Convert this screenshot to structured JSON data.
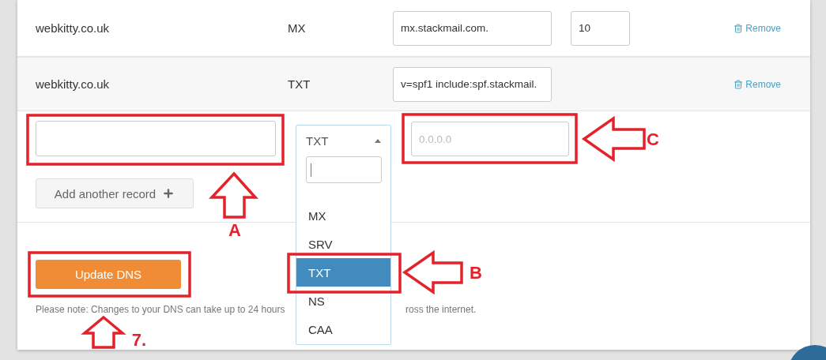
{
  "records": [
    {
      "name": "webkitty.co.uk",
      "type": "MX",
      "value": "mx.stackmail.com.",
      "priority": "10",
      "action": "Remove"
    },
    {
      "name": "webkitty.co.uk",
      "type": "TXT",
      "value": "v=spf1 include:spf.stackmail.",
      "action": "Remove"
    }
  ],
  "new_record": {
    "type_select": {
      "value": "TXT",
      "expanded": true,
      "options": [
        {
          "label": "MX",
          "selected": false
        },
        {
          "label": "SRV",
          "selected": false
        },
        {
          "label": "TXT",
          "selected": true
        },
        {
          "label": "NS",
          "selected": false
        },
        {
          "label": "CAA",
          "selected": false
        }
      ]
    },
    "value": {
      "placeholder": "0.0.0.0"
    }
  },
  "add_button": "Add another record",
  "update_button": "Update DNS",
  "note": [
    "Please note: Changes to your DNS can take up to 24 hours",
    "ross the internet."
  ],
  "annotation_labels": [
    "A",
    "C",
    "B",
    "7."
  ]
}
